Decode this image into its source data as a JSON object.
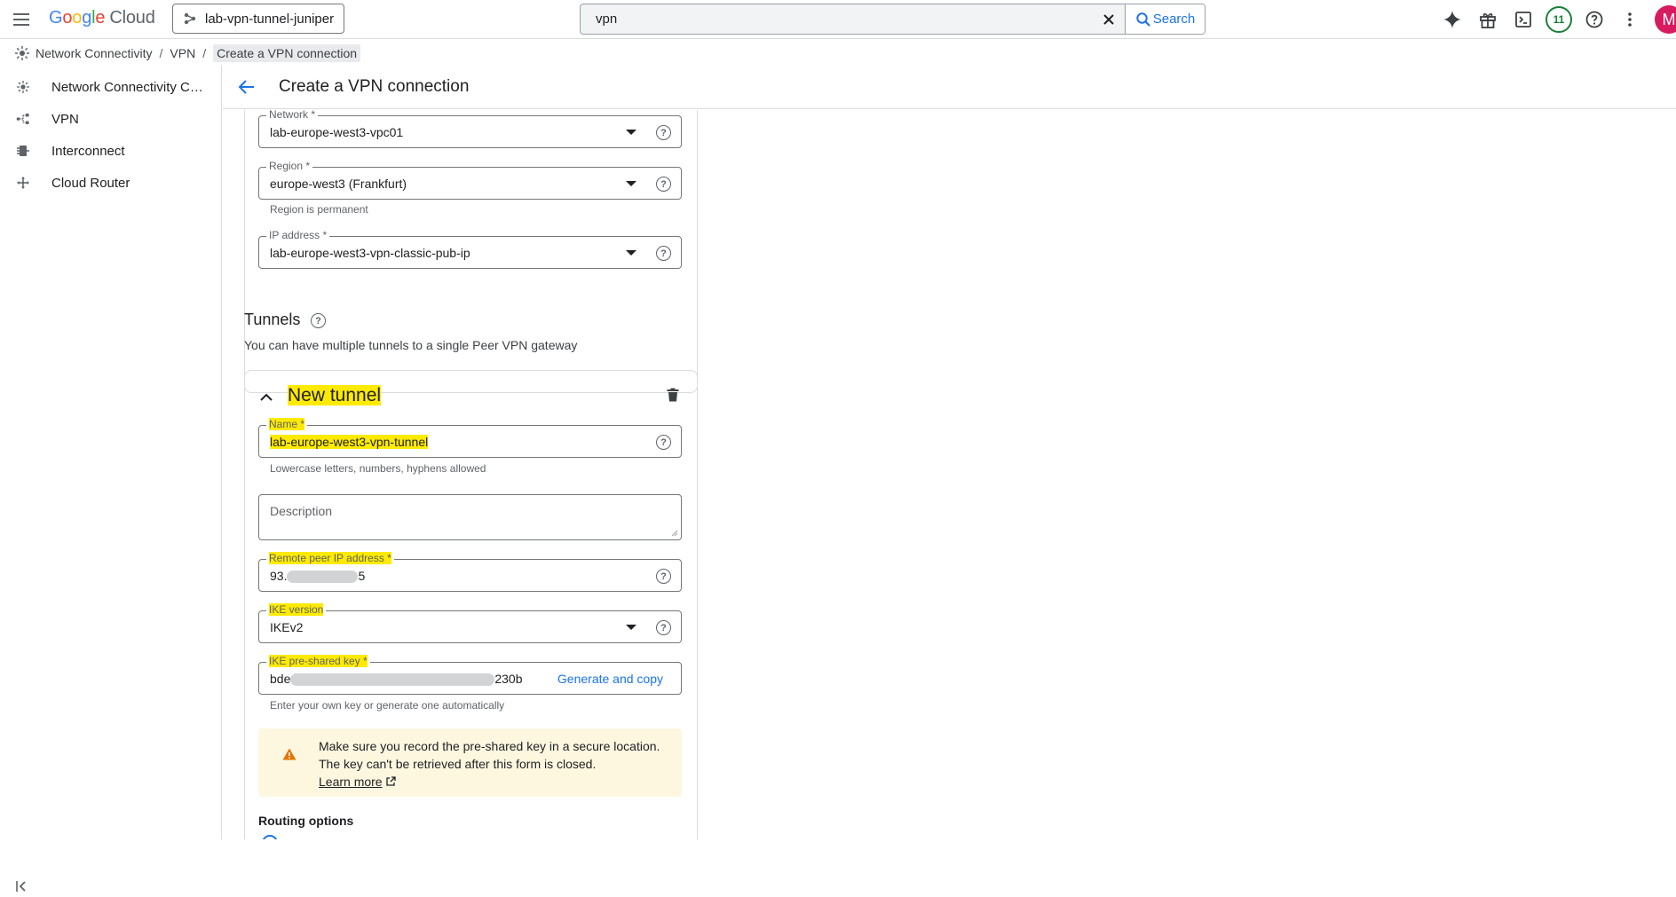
{
  "topbar": {
    "logo_google": "Google",
    "logo_cloud": "Cloud",
    "project": "lab-vpn-tunnel-juniper",
    "search_value": "vpn",
    "search_button": "Search",
    "notifications_count": "11",
    "avatar_initial": "M"
  },
  "breadcrumb": {
    "items": [
      "Network Connectivity",
      "VPN",
      "Create a VPN connection"
    ]
  },
  "sidebar": {
    "items": [
      {
        "label": "Network Connectivity Cen...",
        "icon": "hub-icon"
      },
      {
        "label": "VPN",
        "icon": "vpn-icon"
      },
      {
        "label": "Interconnect",
        "icon": "interconnect-icon"
      },
      {
        "label": "Cloud Router",
        "icon": "router-icon"
      }
    ]
  },
  "header": {
    "title": "Create a VPN connection"
  },
  "gateway": {
    "network_label": "Network *",
    "network_value": "lab-europe-west3-vpc01",
    "region_label": "Region *",
    "region_value": "europe-west3 (Frankfurt)",
    "region_hint": "Region is permanent",
    "ip_label": "IP address *",
    "ip_value": "lab-europe-west3-vpn-classic-pub-ip"
  },
  "tunnels": {
    "title": "Tunnels",
    "description": "You can have multiple tunnels to a single Peer VPN gateway",
    "new_tunnel_title": "New tunnel",
    "name_label": "Name *",
    "name_value": "lab-europe-west3-vpn-tunnel",
    "name_hint": "Lowercase letters, numbers, hyphens allowed",
    "description_placeholder": "Description",
    "peer_ip_label": "Remote peer IP address *",
    "peer_ip_prefix": "93.",
    "peer_ip_suffix": "5",
    "ike_version_label": "IKE version",
    "ike_version_value": "IKEv2",
    "psk_label": "IKE pre-shared key *",
    "psk_prefix": "bde",
    "psk_suffix": "230b",
    "generate_button": "Generate and copy",
    "psk_hint": "Enter your own key or generate one automatically",
    "warning_line1": "Make sure you record the pre-shared key in a secure location.",
    "warning_line2": "The key can't be retrieved after this form is closed.",
    "learn_more": "Learn more",
    "routing_title": "Routing options"
  },
  "colors": {
    "accent": "#1a73e8",
    "highlight": "#ffea00",
    "warning_bg": "#fef7e0",
    "warning_icon": "#e37400"
  }
}
